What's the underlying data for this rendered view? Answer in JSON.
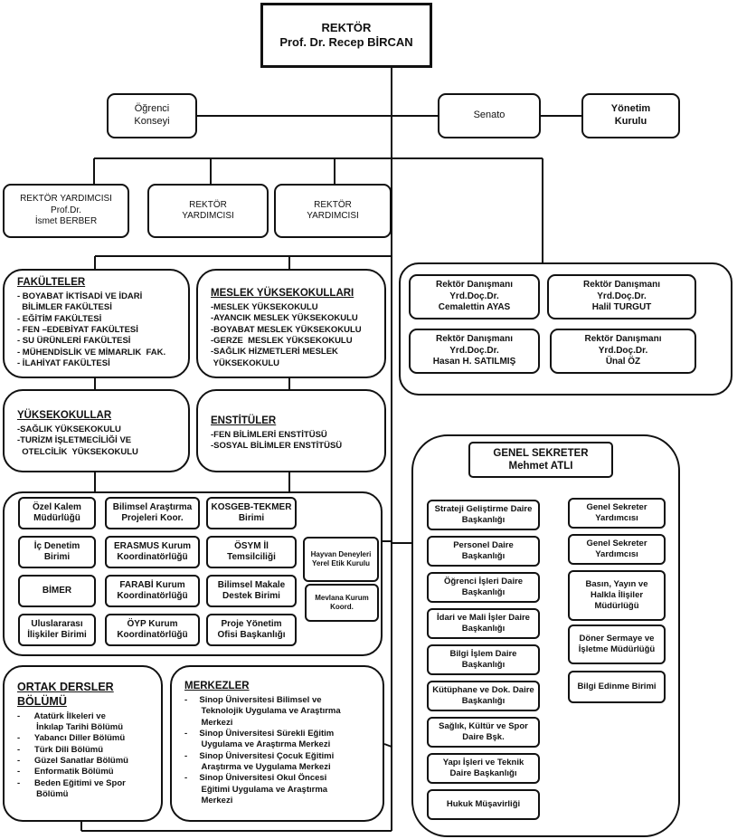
{
  "rector": {
    "title": "REKTÖR",
    "name": "Prof. Dr. Recep BİRCAN"
  },
  "top_boxes": [
    {
      "line1": "Öğrenci",
      "line2": "Konseyi"
    },
    {
      "line1": "Senato",
      "line2": ""
    },
    {
      "line1": "Yönetim",
      "line2": "Kurulu"
    }
  ],
  "vice_rectors": [
    {
      "line1": "REKTÖR YARDIMCISI",
      "line2": "Prof.Dr.",
      "line3": "İsmet BERBER"
    },
    {
      "line1": "REKTÖR",
      "line2": "YARDIMCISI",
      "line3": ""
    },
    {
      "line1": "REKTÖR",
      "line2": "YARDIMCISI",
      "line3": ""
    }
  ],
  "advisors": [
    {
      "line1": "Rektör Danışmanı",
      "line2": "Yrd.Doç.Dr.",
      "line3": "Cemalettin AYAS"
    },
    {
      "line1": "Rektör Danışmanı",
      "line2": "Yrd.Doç.Dr.",
      "line3": "Halil TURGUT"
    },
    {
      "line1": "Rektör Danışmanı",
      "line2": "Yrd.Doç.Dr.",
      "line3": "Hasan H. SATILMIŞ"
    },
    {
      "line1": "Rektör Danışmanı",
      "line2": "Yrd.Doç.Dr.",
      "line3": "Ünal ÖZ"
    }
  ],
  "faculties": {
    "title": "FAKÜLTELER",
    "items": [
      "- BOYABAT İKTİSADİ VE İDARİ\n  BİLİMLER FAKÜLTESİ",
      "- EĞİTİM FAKÜLTESİ",
      "- FEN –EDEBİYAT FAKÜLTESİ",
      "- SU ÜRÜNLERİ FAKÜLTESİ",
      "- MÜHENDİSLİK VE MİMARLIK  FAK.",
      "- İLAHİYAT FAKÜLTESİ"
    ]
  },
  "vocational": {
    "title": "MESLEK YÜKSEKOKULLARI",
    "items": [
      "-MESLEK YÜKSEKOKULU",
      "-AYANCIK MESLEK YÜKSEKOKULU",
      "-BOYABAT MESLEK YÜKSEKOKULU",
      "-GERZE  MESLEK YÜKSEKOKULU",
      "-SAĞLIK HİZMETLERİ MESLEK\n YÜKSEKOKULU"
    ]
  },
  "schools": {
    "title": "YÜKSEKOKULLAR",
    "items": [
      "-SAĞLIK YÜKSEKOKULU",
      "-TURİZM İŞLETMECİLİĞİ VE\n  OTELCİLİK  YÜKSEKOKULU"
    ]
  },
  "institutes": {
    "title": "ENSTİTÜLER",
    "items": [
      "-FEN BİLİMLERİ ENSTİTÜSÜ",
      "-SOSYAL BİLİMLER ENSTİTÜSÜ"
    ]
  },
  "units": [
    "Özel Kalem Müdürlüğü",
    "Bilimsel Araştırma Projeleri Koor.",
    "KOSGEB-TEKMER Birimi",
    "İç Denetim Birimi",
    "ERASMUS Kurum Koordinatörlüğü",
    "ÖSYM İl Temsilciliği",
    "BİMER",
    "FARABİ Kurum Koordinatörlüğü",
    "Bilimsel Makale Destek Birimi",
    "Uluslararası İlişkiler Birimi",
    "ÖYP Kurum Koordinatörlüğü",
    "Proje Yönetim Ofisi Başkanlığı",
    "Hayvan Deneyleri Yerel Etik Kurulu",
    "Mevlana Kurum Koord."
  ],
  "common_courses": {
    "title": "ORTAK DERSLER BÖLÜMÜ",
    "items": [
      "-      Atatürk İlkeleri ve\n        İnkılap Tarihi Bölümü",
      "-      Yabancı Diller Bölümü",
      "-      Türk Dili Bölümü",
      "-      Güzel Sanatlar Bölümü",
      "-      Enformatik Bölümü",
      "-      Beden Eğitimi ve Spor\n        Bölümü"
    ]
  },
  "centers": {
    "title": "MERKEZLER",
    "items": [
      "-     Sinop Üniversitesi Bilimsel ve\n       Teknolojik Uygulama ve Araştırma\n       Merkezi",
      "-     Sinop Üniversitesi Sürekli Eğitim\n       Uygulama ve Araştırma Merkezi",
      "-     Sinop Üniversitesi Çocuk Eğitimi\n       Araştırma ve Uygulama Merkezi",
      "-     Sinop Üniversitesi Okul Öncesi\n       Eğitimi Uygulama ve Araştırma\n       Merkezi"
    ]
  },
  "secretary": {
    "title": "GENEL SEKRETER",
    "name": "Mehmet ATLI",
    "left": [
      "Strateji Geliştirme Daire Başkanlığı",
      "Personel Daire Başkanlığı",
      "Öğrenci İşleri Daire Başkanlığı",
      "İdari ve Mali İşler Daire Başkanlığı",
      "Bilgi İşlem Daire Başkanlığı",
      "Kütüphane ve Dok. Daire Başkanlığı",
      "Sağlık, Kültür ve Spor Daire Bşk.",
      "Yapı İşleri ve Teknik Daire Başkanlığı",
      "Hukuk Müşavirliği"
    ],
    "right": [
      "Genel Sekreter Yardımcısı",
      "Genel Sekreter Yardımcısı",
      "Basın, Yayın ve Halkla İlişiler Müdürlüğü",
      "Döner Sermaye ve İşletme Müdürlüğü",
      "Bilgi Edinme Birimi"
    ]
  }
}
